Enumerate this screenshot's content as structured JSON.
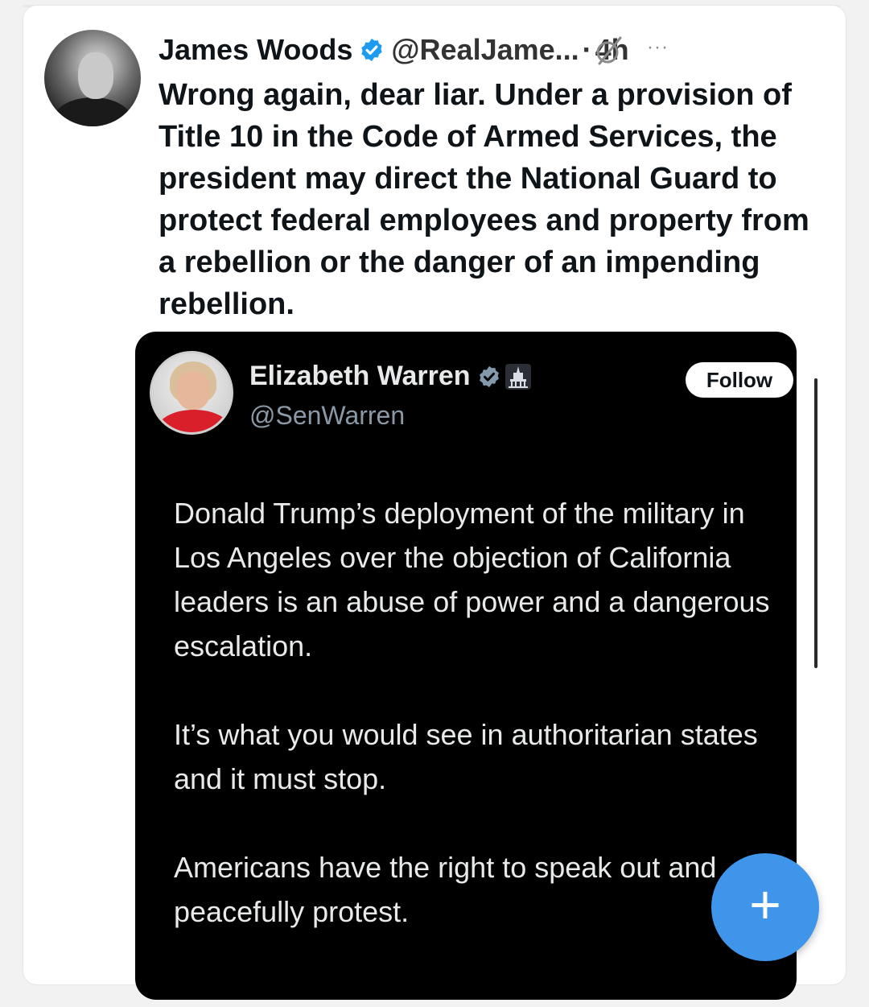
{
  "post": {
    "author_name": "James Woods",
    "handle": "@RealJame...",
    "separator": "·",
    "time": "4h",
    "more_label": "···",
    "text": "Wrong again, dear liar. Under a provision of Title 10 in the Code of Armed Services, the president may direct the National Guard to protect federal employees and property from a rebellion or the danger of an impending rebellion."
  },
  "quoted": {
    "author_name": "Elizabeth Warren",
    "handle": "@SenWarren",
    "follow_label": "Follow",
    "paragraphs": [
      "Donald Trump’s deployment of the military in Los Angeles over the objection of California leaders is an abuse of power and a dangerous escalation.",
      "It’s what you would see in authoritarian states and it must stop.",
      "Americans have the right to speak out and peacefully protest."
    ]
  },
  "fab": {
    "label": "+"
  },
  "colors": {
    "verified_blue": "#1d9bf0",
    "fab_blue": "#3f95ea",
    "quote_bg": "#000000",
    "gov_badge_gray": "#829aab"
  },
  "icons": {
    "verified": "verified-badge-icon",
    "grok": "grok-icon",
    "more": "more-icon",
    "government": "government-badge-icon",
    "compose": "compose-plus-icon"
  }
}
